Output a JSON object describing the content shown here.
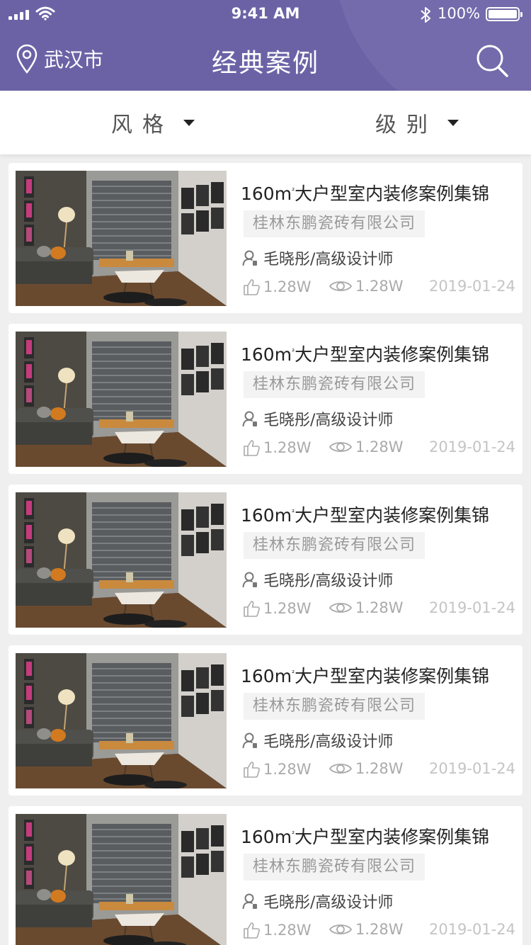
{
  "status_bar": {
    "time": "9:41 AM",
    "battery": "100%"
  },
  "header": {
    "location": "武汉市",
    "title": "经典案例"
  },
  "filters": {
    "style_label": "风格",
    "level_label": "级别"
  },
  "cases": [
    {
      "title_main": "160m",
      "title_sup": "²",
      "title_rest": "大户型室内装修案例集锦",
      "company": "桂林东鹏瓷砖有限公司",
      "designer": "毛晓彤/高级设计师",
      "likes": "1.28W",
      "views": "1.28W",
      "date": "2019-01-24"
    },
    {
      "title_main": "160m",
      "title_sup": "²",
      "title_rest": "大户型室内装修案例集锦",
      "company": "桂林东鹏瓷砖有限公司",
      "designer": "毛晓彤/高级设计师",
      "likes": "1.28W",
      "views": "1.28W",
      "date": "2019-01-24"
    },
    {
      "title_main": "160m",
      "title_sup": "²",
      "title_rest": "大户型室内装修案例集锦",
      "company": "桂林东鹏瓷砖有限公司",
      "designer": "毛晓彤/高级设计师",
      "likes": "1.28W",
      "views": "1.28W",
      "date": "2019-01-24"
    },
    {
      "title_main": "160m",
      "title_sup": "²",
      "title_rest": "大户型室内装修案例集锦",
      "company": "桂林东鹏瓷砖有限公司",
      "designer": "毛晓彤/高级设计师",
      "likes": "1.28W",
      "views": "1.28W",
      "date": "2019-01-24"
    },
    {
      "title_main": "160m",
      "title_sup": "²",
      "title_rest": "大户型室内装修案例集锦",
      "company": "桂林东鹏瓷砖有限公司",
      "designer": "毛晓彤/高级设计师",
      "likes": "1.28W",
      "views": "1.28W",
      "date": "2019-01-24"
    }
  ],
  "colors": {
    "header_bg": "#6b62a6",
    "muted_text": "#999999",
    "date_text": "#c4c4c4"
  }
}
